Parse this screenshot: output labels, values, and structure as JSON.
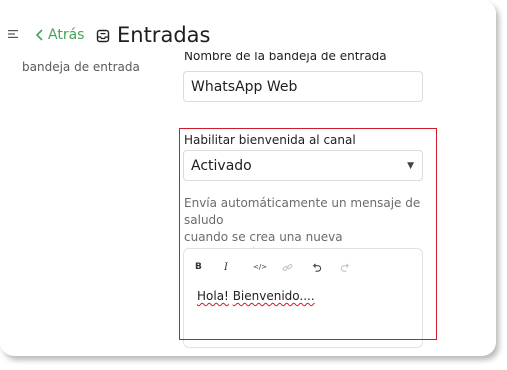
{
  "header": {
    "back_label": "Atrás",
    "title": "Entradas"
  },
  "left_section_label": "bandeja de entrada",
  "inbox_name": {
    "label": "Nombre de la bandeja de entrada",
    "value": "WhatsApp Web"
  },
  "welcome": {
    "label": "Habilitar bienvenida al canal",
    "selected": "Activado",
    "help_line1": "Envía automáticamente un mensaje de saludo",
    "help_line2": "cuando se crea una nueva conversación."
  },
  "editor": {
    "toolbar": [
      {
        "name": "bold",
        "glyph": "B"
      },
      {
        "name": "italic",
        "glyph": "I"
      },
      {
        "name": "code",
        "glyph": "</>"
      },
      {
        "name": "link",
        "glyph": "link",
        "disabled": true
      },
      {
        "name": "undo",
        "glyph": "undo"
      },
      {
        "name": "redo",
        "glyph": "redo",
        "disabled": true
      }
    ],
    "text_part1": "Hola!",
    "text_part2": "Bienvenido....",
    "text_space": " "
  },
  "colors": {
    "accent_green": "#44a55a",
    "highlight_red": "#d11a2a"
  }
}
